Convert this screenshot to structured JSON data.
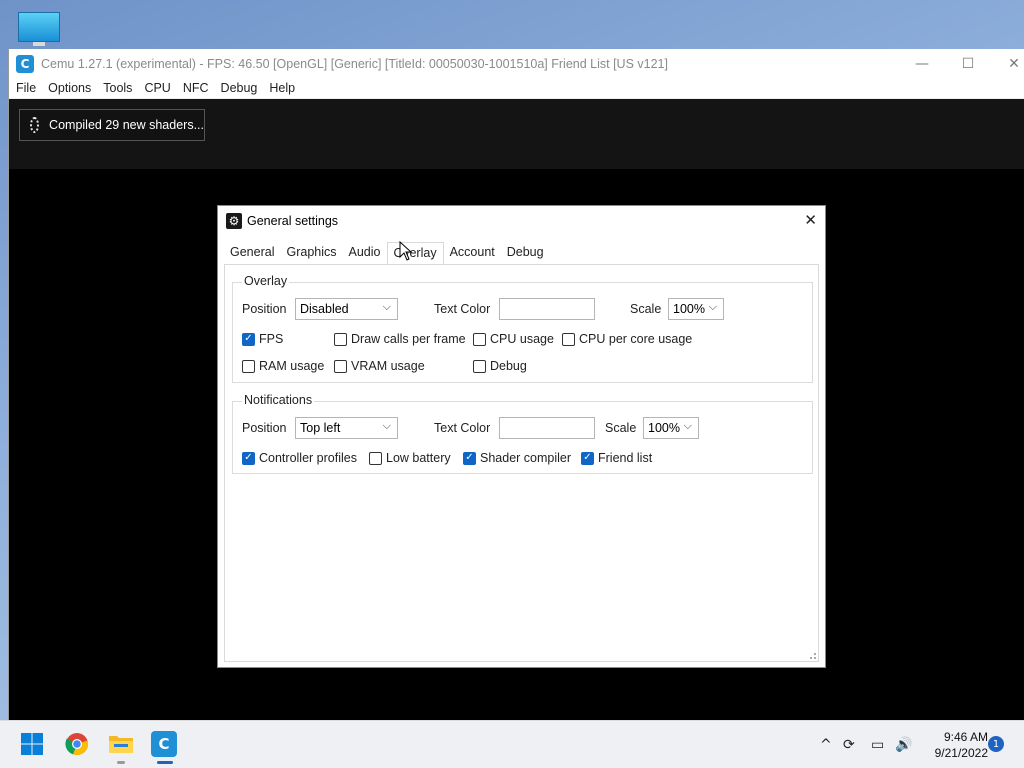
{
  "window": {
    "app_icon_letter": "C",
    "title": "Cemu 1.27.1 (experimental) - FPS: 46.50 [OpenGL] [Generic] [TitleId: 00050030-1001510a] Friend List [US v121]",
    "minimize": "—",
    "maximize": "☐",
    "close": "✕"
  },
  "menu": [
    "File",
    "Options",
    "Tools",
    "CPU",
    "NFC",
    "Debug",
    "Help"
  ],
  "toast": {
    "text": "Compiled 29 new shaders..."
  },
  "dialog": {
    "title": "General settings",
    "close": "✕",
    "tabs": [
      "General",
      "Graphics",
      "Audio",
      "Overlay",
      "Account",
      "Debug"
    ],
    "active_tab": "Overlay",
    "overlay": {
      "group_title": "Overlay",
      "position_label": "Position",
      "position_value": "Disabled",
      "text_color_label": "Text Color",
      "text_color_value": "",
      "scale_label": "Scale",
      "scale_value": "100%",
      "checkboxes": [
        {
          "label": "FPS",
          "checked": true
        },
        {
          "label": "Draw calls per frame",
          "checked": false
        },
        {
          "label": "CPU usage",
          "checked": false
        },
        {
          "label": "CPU per core usage",
          "checked": false
        },
        {
          "label": "RAM usage",
          "checked": false
        },
        {
          "label": "VRAM usage",
          "checked": false
        },
        {
          "label": "Debug",
          "checked": false
        }
      ]
    },
    "notifications": {
      "group_title": "Notifications",
      "position_label": "Position",
      "position_value": "Top left",
      "text_color_label": "Text Color",
      "text_color_value": "",
      "scale_label": "Scale",
      "scale_value": "100%",
      "checkboxes": [
        {
          "label": "Controller profiles",
          "checked": true
        },
        {
          "label": "Low battery",
          "checked": false
        },
        {
          "label": "Shader compiler",
          "checked": true
        },
        {
          "label": "Friend list",
          "checked": true
        }
      ]
    }
  },
  "taskbar": {
    "apps": [
      "windows-start",
      "chrome",
      "file-explorer",
      "cemu"
    ],
    "tray_icons": [
      "chevron-up",
      "sync",
      "network",
      "volume"
    ],
    "time": "9:46 AM",
    "date": "9/21/2022",
    "notification_count": "1"
  },
  "colors": {
    "checkbox_accent": "#0f66c5",
    "cemu_brand": "#1f8fd6"
  }
}
